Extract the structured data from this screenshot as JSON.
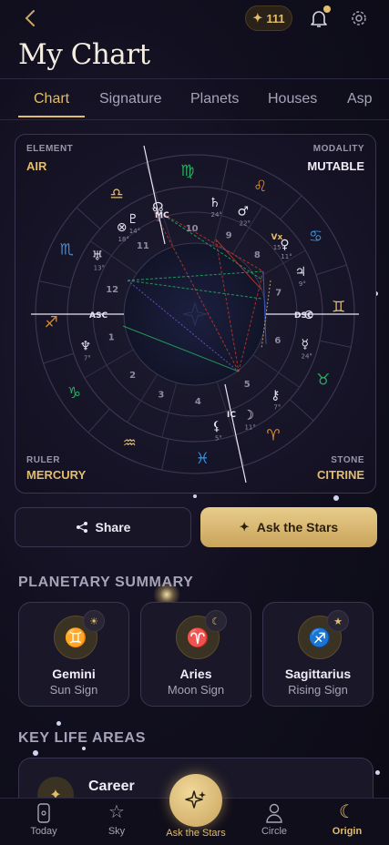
{
  "header": {
    "back_icon": "chevron-left-icon",
    "credits": "111",
    "credits_icon": "sparkle-icon",
    "bell_icon": "bell-icon",
    "settings_icon": "gear-icon",
    "title": "My Chart"
  },
  "tabs": [
    "Chart",
    "Signature",
    "Planets",
    "Houses",
    "Asp"
  ],
  "active_tab": "Chart",
  "chart": {
    "element_label": "ELEMENT",
    "element_value": "AIR",
    "modality_label": "MODALITY",
    "modality_value": "MUTABLE",
    "ruler_label": "RULER",
    "ruler_value": "MERCURY",
    "stone_label": "STONE",
    "stone_value": "CITRINE",
    "axis_asc": "ASC",
    "axis_dsc": "DSC",
    "axis_mc": "MC",
    "axis_ic": "IC",
    "houses": [
      "1",
      "2",
      "3",
      "4",
      "5",
      "6",
      "7",
      "8",
      "9",
      "10",
      "11",
      "12"
    ],
    "zodiac_glyphs": [
      "♍",
      "♌",
      "♋",
      "♊",
      "♉",
      "♈",
      "♓",
      "♒",
      "♑",
      "♐",
      "♏",
      "♎"
    ],
    "planet_labels": [
      {
        "glyph": "☊",
        "deg": "3°"
      },
      {
        "glyph": "♇",
        "deg": "14°"
      },
      {
        "glyph": "♄",
        "deg": "24°"
      },
      {
        "glyph": "♂",
        "deg": "22°"
      },
      {
        "glyph": "♀",
        "deg": "11°"
      },
      {
        "glyph": "Vx",
        "deg": "15°"
      },
      {
        "glyph": "♃",
        "deg": "9°"
      },
      {
        "glyph": "⊙",
        "deg": ""
      },
      {
        "glyph": "☿",
        "deg": "24°"
      },
      {
        "glyph": "⚷",
        "deg": "7°"
      },
      {
        "glyph": "☽",
        "deg": "11°"
      },
      {
        "glyph": "⚸",
        "deg": "5°"
      },
      {
        "glyph": "♅",
        "deg": "13°"
      },
      {
        "glyph": "♆",
        "deg": "7°"
      },
      {
        "glyph": "⊗",
        "deg": "18°"
      }
    ],
    "colors": {
      "gold": "#e2bd6b",
      "air": "#e2bd6b",
      "text": "#e9e4f2",
      "red": "#c0392b",
      "green": "#27ae60",
      "blue": "#3b5bdb"
    }
  },
  "actions": {
    "share_label": "Share",
    "share_icon": "share-icon",
    "ask_label": "Ask the Stars",
    "ask_icon": "sparkles-icon"
  },
  "planetary_summary": {
    "title": "PLANETARY SUMMARY",
    "cards": [
      {
        "glyph": "♊",
        "badge": "☀",
        "name": "Gemini",
        "sub": "Sun Sign"
      },
      {
        "glyph": "♈",
        "badge": "☾",
        "name": "Aries",
        "sub": "Moon Sign"
      },
      {
        "glyph": "♐",
        "badge": "★",
        "name": "Sagittarius",
        "sub": "Rising Sign"
      }
    ]
  },
  "key_life_areas": {
    "title": "KEY LIFE AREAS",
    "first_item": "Career",
    "first_icon": "sparkles-icon"
  },
  "nav": {
    "items": [
      {
        "label": "Today",
        "icon": "phone-icon"
      },
      {
        "label": "Sky",
        "icon": "star-icon"
      },
      {
        "label": "Ask the Stars",
        "icon": "sparkles-icon"
      },
      {
        "label": "Circle",
        "icon": "person-icon"
      },
      {
        "label": "Origin",
        "icon": "moon-icon"
      }
    ],
    "active": "Origin"
  }
}
